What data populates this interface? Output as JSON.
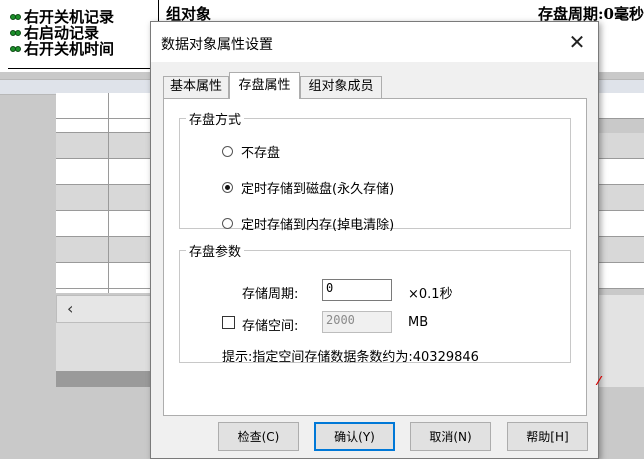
{
  "background": {
    "list_items": [
      "右开关机记录",
      "右启动记录",
      "右开关机时间"
    ],
    "group_title": "组对象",
    "period_text": "存盘周期:0毫秒"
  },
  "dialog": {
    "title": "数据对象属性设置",
    "close_icon": "close-icon",
    "tabs": [
      "基本属性",
      "存盘属性",
      "组对象成员"
    ],
    "active_tab": "存盘属性",
    "storage_mode": {
      "legend": "存盘方式",
      "options": [
        "不存盘",
        "定时存储到磁盘(永久存储)",
        "定时存储到内存(掉电清除)"
      ],
      "selected": "定时存储到磁盘(永久存储)"
    },
    "storage_params": {
      "legend": "存盘参数",
      "period_label": "存储周期:",
      "period_value": "0",
      "period_unit": "×0.1秒",
      "space_label": "存储空间:",
      "space_checked": false,
      "space_value": "2000",
      "space_unit": "MB",
      "hint": "提示:指定空间存储数据条数约为:40329846"
    },
    "buttons": {
      "check": "检查(C)",
      "confirm": "确认(Y)",
      "cancel": "取消(N)",
      "help": "帮助[H]"
    }
  },
  "colors": {
    "accent": "#0078d7",
    "dialog_bg": "#f0f0f0",
    "status_icon": "#1d8f2a"
  }
}
